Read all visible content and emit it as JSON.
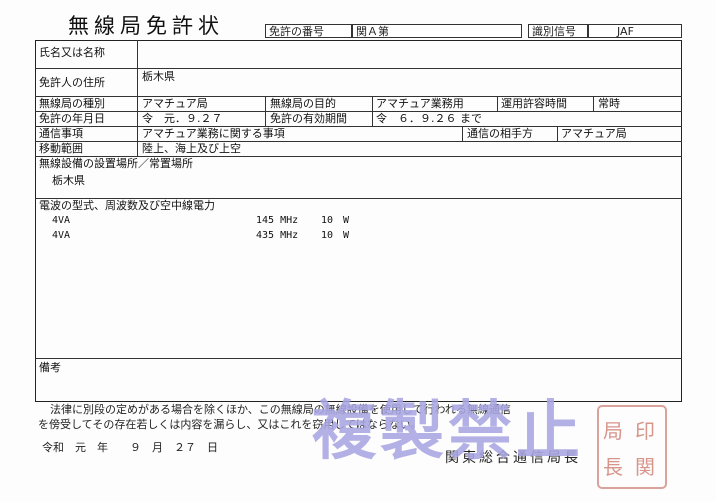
{
  "title": "無線局免許状",
  "header": {
    "license_number_label": "免許の番号",
    "license_number_value": "関Ａ第",
    "call_sign_label": "識別信号",
    "call_sign_value": "JAF"
  },
  "rows": {
    "name_label": "氏名又は名称",
    "name_value": "",
    "address_label": "免許人の住所",
    "address_value": "栃木県",
    "station_type_label": "無線局の種別",
    "station_type_value": "アマチュア局",
    "purpose_label": "無線局の目的",
    "purpose_value": "アマチュア業務用",
    "operating_hours_label": "運用許容時間",
    "operating_hours_value": "常時",
    "license_date_label": "免許の年月日",
    "license_date_value": "令　元．９.２７",
    "validity_label": "免許の有効期間",
    "validity_value": "令　６．９.２６ まで",
    "comm_matters_label": "通信事項",
    "comm_matters_value": "アマチュア業務に関する事項",
    "comm_partner_label": "通信の相手方",
    "comm_partner_value": "アマチュア局",
    "mobile_range_label": "移動範囲",
    "mobile_range_value": "陸上、海上及び上空",
    "location_label": "無線設備の設置場所／常置場所",
    "location_value": "栃木県",
    "emission_label": "電波の型式、周波数及び空中線電力",
    "emissions": [
      {
        "type": "4VA",
        "freq": "145 MHz",
        "power": "10　W"
      },
      {
        "type": "4VA",
        "freq": "435 MHz",
        "power": "10　W"
      }
    ],
    "remarks_label": "備考"
  },
  "footer": {
    "notice_line1": "法律に別段の定めがある場合を除くほか、この無線局の無線設備を使用して行われる無線通信",
    "notice_line2": "を傍受してその存在若しくは内容を漏らし、又はこれを窃用してはならない。",
    "issue_date": "令和　元　年　　９　月　２７　日",
    "issuer": "関東総合通信局長"
  },
  "watermark": "複製禁止",
  "seal_text": "関東総合通信局長印"
}
